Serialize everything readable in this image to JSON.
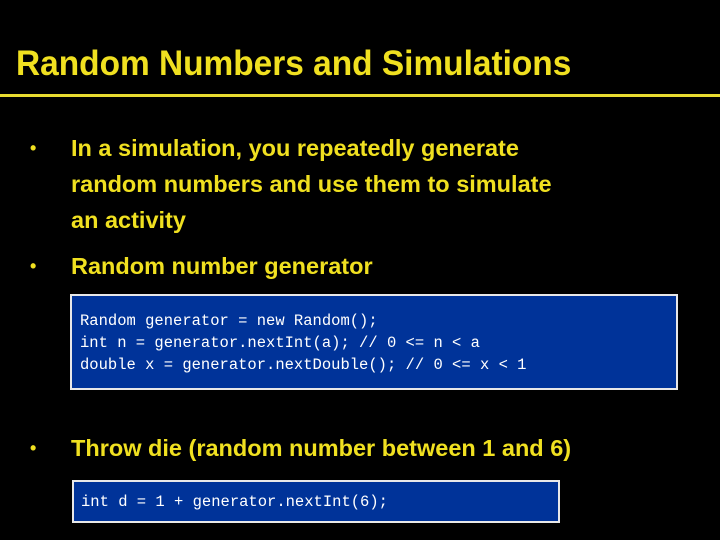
{
  "slide": {
    "title": "Random Numbers and Simulations",
    "colors": {
      "background": "#000000",
      "title_text": "#F0E020",
      "rule": "#E8DC30",
      "code_box_fill": "#003399",
      "code_box_border": "#E8E8E8",
      "code_text": "#FFFFFF"
    },
    "bullets": [
      {
        "marker": "•",
        "lines": [
          "In a simulation, you repeatedly generate",
          "random numbers and use them to simulate",
          "an activity"
        ]
      },
      {
        "marker": "•",
        "lines": [
          "Random number generator"
        ]
      },
      {
        "marker": "•",
        "lines": [
          "Throw die (random number between 1 and 6)"
        ]
      }
    ],
    "code_blocks": [
      {
        "lines": [
          "Random generator = new Random();",
          "int n = generator.nextInt(a); // 0 <= n < a",
          "double x = generator.nextDouble(); // 0 <= x < 1"
        ]
      },
      {
        "lines": [
          "int d = 1 + generator.nextInt(6);"
        ]
      }
    ]
  }
}
